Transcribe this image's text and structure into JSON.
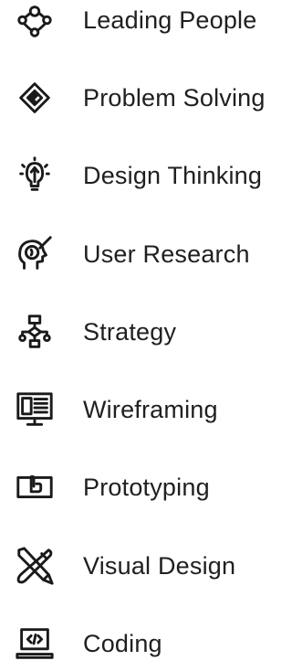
{
  "skills": [
    {
      "label": "Leading People",
      "icon": "leading-people-icon"
    },
    {
      "label": "Problem Solving",
      "icon": "problem-solving-icon"
    },
    {
      "label": "Design Thinking",
      "icon": "design-thinking-icon"
    },
    {
      "label": "User Research",
      "icon": "user-research-icon"
    },
    {
      "label": "Strategy",
      "icon": "strategy-icon"
    },
    {
      "label": "Wireframing",
      "icon": "wireframing-icon"
    },
    {
      "label": "Prototyping",
      "icon": "prototyping-icon"
    },
    {
      "label": "Visual Design",
      "icon": "visual-design-icon"
    },
    {
      "label": "Coding",
      "icon": "coding-icon"
    }
  ],
  "colors": {
    "text": "#202020",
    "icon": "#1a1a1a",
    "background": "#ffffff"
  }
}
